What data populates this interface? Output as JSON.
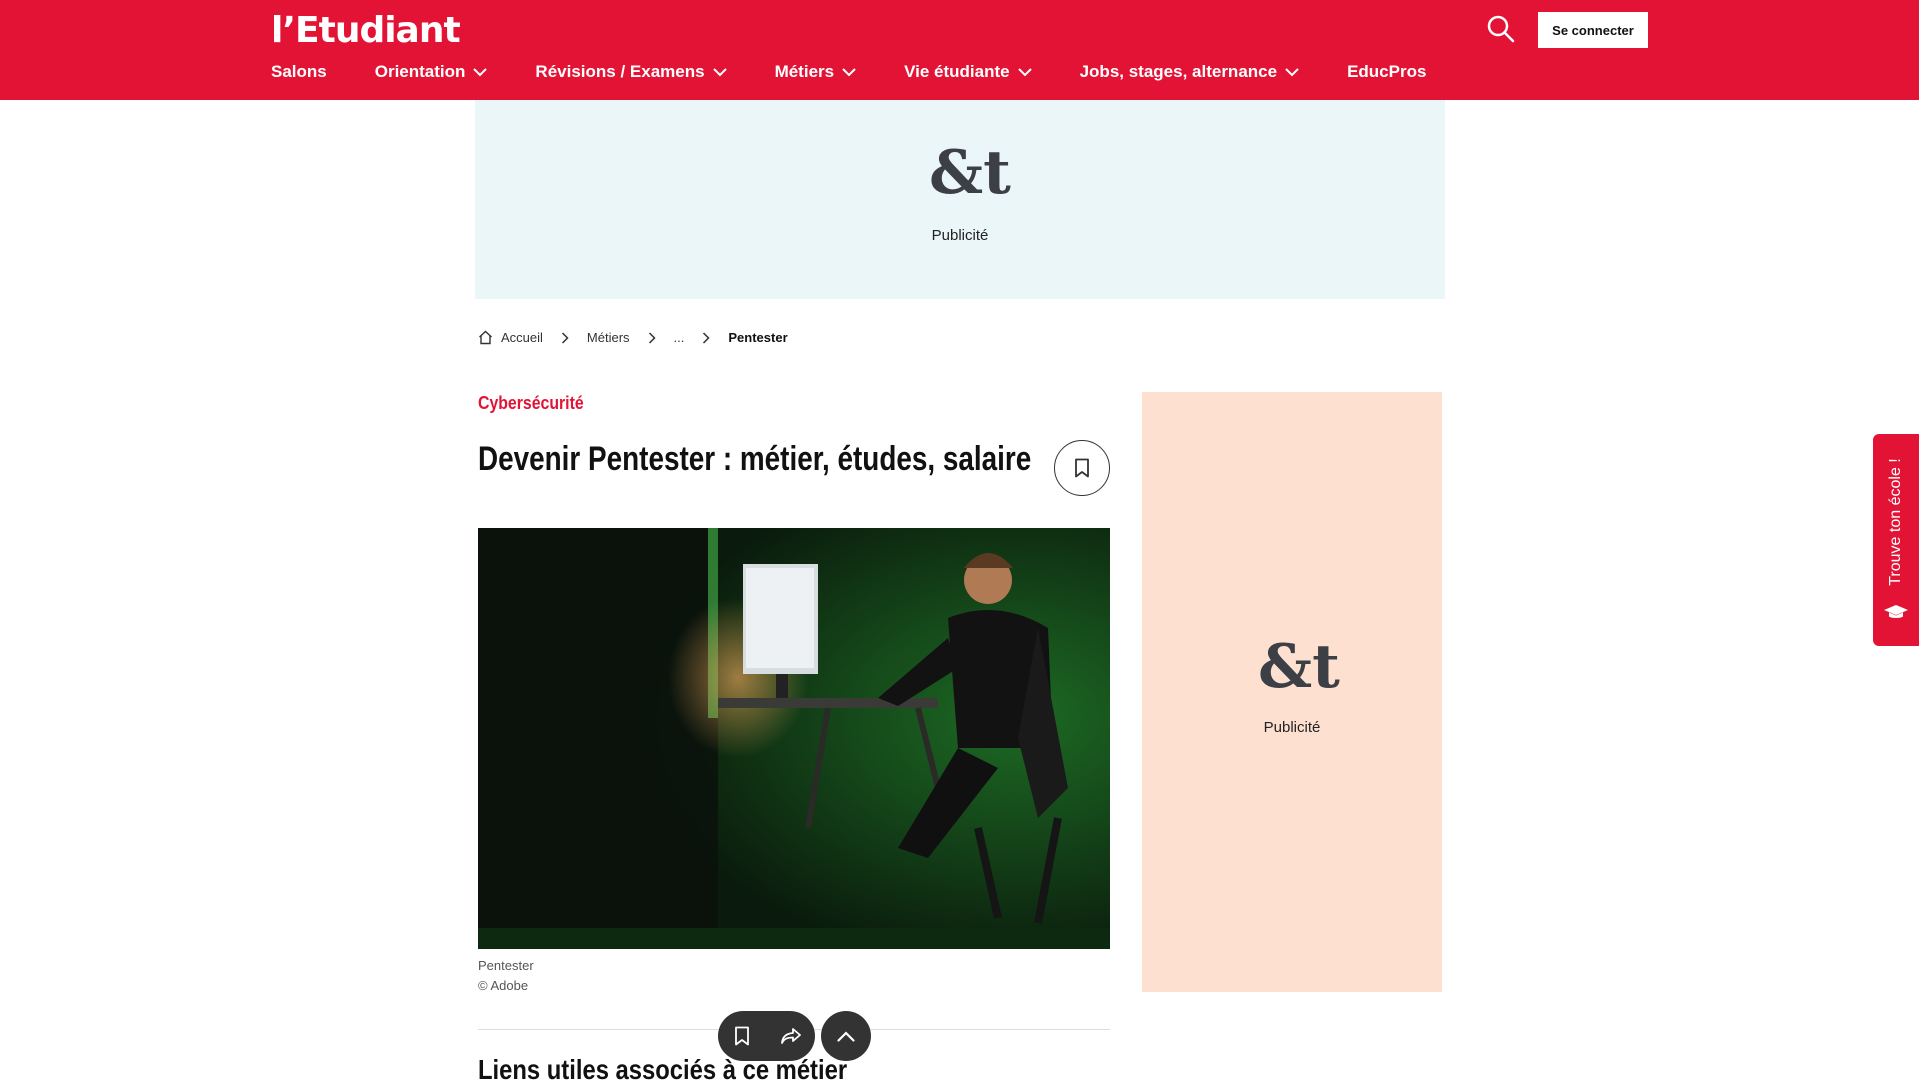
{
  "header": {
    "logo": "l’Etudiant",
    "login_label": "Se connecter",
    "nav": [
      {
        "label": "Salons",
        "dropdown": false
      },
      {
        "label": "Orientation",
        "dropdown": true
      },
      {
        "label": "Révisions / Examens",
        "dropdown": true
      },
      {
        "label": "Métiers",
        "dropdown": true
      },
      {
        "label": "Vie étudiante",
        "dropdown": true
      },
      {
        "label": "Jobs, stages, alternance",
        "dropdown": true
      },
      {
        "label": "EducPros",
        "dropdown": false
      }
    ]
  },
  "ads": {
    "top": {
      "mark": "&t",
      "label": "Publicité"
    },
    "side": {
      "mark": "&t",
      "label": "Publicité"
    }
  },
  "breadcrumb": {
    "home": "Accueil",
    "level1": "Métiers",
    "ellipsis": "...",
    "current": "Pentester"
  },
  "article": {
    "category": "Cybersécurité",
    "title": "Devenir Pentester : métier, études, salaire",
    "photo_caption": "Pentester",
    "photo_credit": "© Adobe",
    "section_title": "Liens utiles associés à ce métier"
  },
  "side_tab": {
    "label": "Trouve ton école !"
  },
  "colors": {
    "brand_red": "#e31336",
    "ad_blue": "#ebf6f8",
    "ad_peach": "#fde0d0"
  },
  "icons": [
    "search-icon",
    "home-icon",
    "chevron-right-icon",
    "chevron-down-icon",
    "bookmark-icon",
    "share-icon",
    "arrow-up-icon",
    "graduation-cap-icon"
  ]
}
